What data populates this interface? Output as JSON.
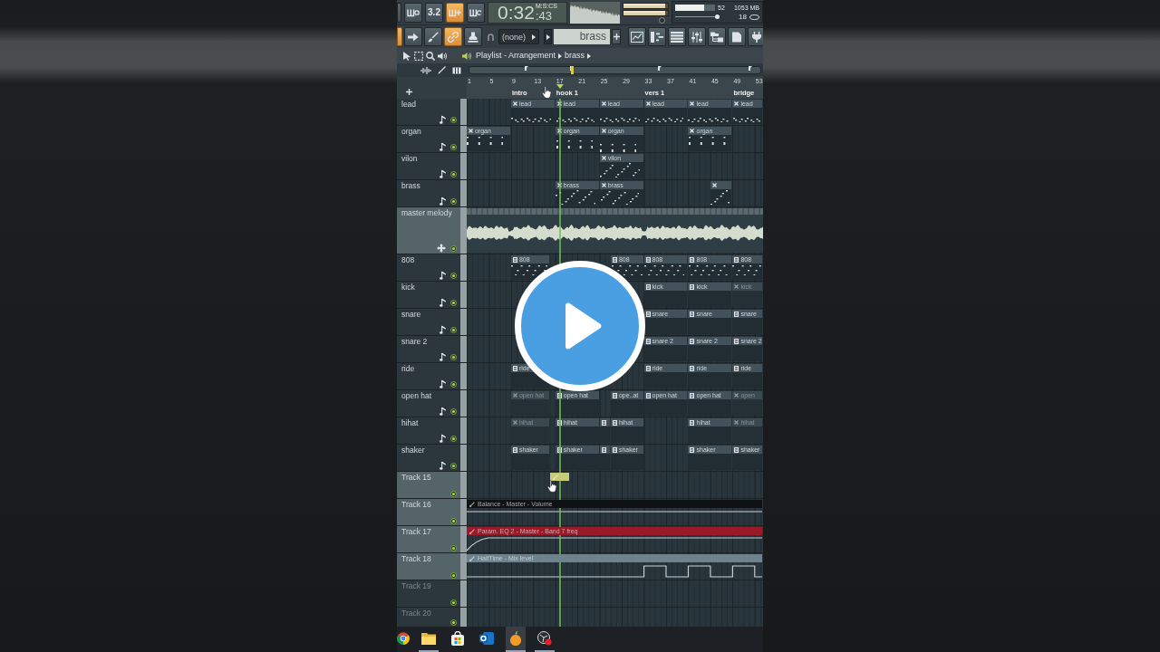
{
  "toolbar": {
    "top_buttons": [
      {
        "kind": "sliver",
        "on": false
      },
      {
        "kind": "typing",
        "on": false
      },
      {
        "kind": "countdown",
        "label": "3.2",
        "on": false
      },
      {
        "kind": "overdub",
        "on": true
      },
      {
        "kind": "loop",
        "on": false
      }
    ],
    "time": {
      "main": "0:32",
      "fraction": ":43",
      "units": "M:S:CS"
    },
    "meters": [
      {
        "level": 0.93
      },
      {
        "level": 0.93
      }
    ],
    "usage": {
      "meter": {
        "level": 0.72
      },
      "reading": "52",
      "memory": "1053 MB",
      "slider": {
        "level": 0.97
      },
      "voices": "18"
    },
    "bottom_buttons": [
      {
        "kind": "sliver",
        "on": true
      },
      {
        "kind": "arrow",
        "on": false
      },
      {
        "kind": "brush",
        "on": false
      },
      {
        "kind": "link",
        "on": true
      },
      {
        "kind": "stamp",
        "on": false
      }
    ],
    "snap": "(none)",
    "pattern": "brass"
  },
  "playlist": {
    "path": [
      "Playlist - Arrangement",
      "brass"
    ]
  },
  "ruler": {
    "bars": [
      "1",
      "5",
      "9",
      "13",
      "17",
      "21",
      "25",
      "29",
      "33",
      "37",
      "41",
      "45",
      "49",
      "53"
    ],
    "markers": [
      "intro",
      "hook 1",
      "vers 1",
      "bridge"
    ]
  },
  "tracks": [
    {
      "name": "lead",
      "kind": "instrument",
      "selected": false,
      "enabled": true,
      "clips": [
        {
          "kind": "cross",
          "dimmed": false,
          "label": "lead"
        },
        {
          "kind": "cross",
          "dimmed": false,
          "label": "lead"
        },
        {
          "kind": "cross",
          "dimmed": false,
          "label": "lead"
        },
        {
          "kind": "cross",
          "dimmed": false,
          "label": "lead"
        },
        {
          "kind": "cross",
          "dimmed": false,
          "label": "lead"
        },
        {
          "kind": "cross",
          "dimmed": false,
          "label": "lead"
        }
      ]
    },
    {
      "name": "organ",
      "kind": "instrument",
      "selected": false,
      "enabled": true,
      "clips": [
        {
          "kind": "cross",
          "dimmed": false,
          "label": "organ"
        },
        {
          "kind": "cross",
          "dimmed": false,
          "label": "organ"
        },
        {
          "kind": "cross",
          "dimmed": false,
          "label": "organ"
        },
        {
          "kind": "cross",
          "dimmed": false,
          "label": "organ"
        }
      ]
    },
    {
      "name": "vilon",
      "kind": "instrument",
      "selected": false,
      "enabled": true,
      "clips": [
        {
          "kind": "cross",
          "dimmed": false,
          "label": "vilon"
        }
      ]
    },
    {
      "name": "brass",
      "kind": "instrument",
      "selected": false,
      "enabled": true,
      "clips": [
        {
          "kind": "cross",
          "dimmed": false,
          "label": "brass"
        },
        {
          "kind": "cross",
          "dimmed": false,
          "label": "brass"
        },
        {
          "kind": "cross",
          "dimmed": false
        }
      ]
    },
    {
      "name": "master melody",
      "kind": "audio",
      "selected": true,
      "enabled": true
    },
    {
      "name": "808",
      "kind": "instrument",
      "selected": false,
      "enabled": true,
      "clips": [
        {
          "kind": "list",
          "dimmed": false,
          "label": "808"
        },
        {
          "kind": "list",
          "dimmed": false,
          "label": "808"
        },
        {
          "kind": "list",
          "dimmed": false,
          "label": "808"
        },
        {
          "kind": "list",
          "dimmed": false,
          "label": "808"
        },
        {
          "kind": "list",
          "dimmed": false,
          "label": "808"
        }
      ]
    },
    {
      "name": "kick",
      "kind": "instrument",
      "selected": false,
      "enabled": true,
      "clips": [
        {
          "kind": "list",
          "dimmed": false,
          "label": "kick"
        },
        {
          "kind": "list",
          "dimmed": false,
          "label": "kick"
        },
        {
          "kind": "cross",
          "dimmed": true,
          "label": "kick"
        }
      ]
    },
    {
      "name": "snare",
      "kind": "instrument",
      "selected": false,
      "enabled": true,
      "clips": [
        {
          "kind": "list",
          "dimmed": false,
          "label": "snare"
        },
        {
          "kind": "list",
          "dimmed": false,
          "label": "snare"
        },
        {
          "kind": "list",
          "dimmed": false,
          "label": "snare"
        }
      ]
    },
    {
      "name": "snare 2",
      "kind": "instrument",
      "selected": false,
      "enabled": true,
      "clips": [
        {
          "kind": "list",
          "dimmed": false,
          "label": "snare 2"
        },
        {
          "kind": "list",
          "dimmed": false,
          "label": "snare 2"
        },
        {
          "kind": "list",
          "dimmed": false,
          "label": "snare 2"
        }
      ]
    },
    {
      "name": "ride",
      "kind": "instrument",
      "selected": false,
      "enabled": true,
      "clips": [
        {
          "kind": "list",
          "dimmed": false,
          "label": "ride"
        },
        {
          "kind": "list",
          "dimmed": false,
          "label": "ride"
        },
        {
          "kind": "list",
          "dimmed": false,
          "label": "ride"
        },
        {
          "kind": "list",
          "dimmed": false,
          "label": "ride"
        }
      ]
    },
    {
      "name": "open hat",
      "kind": "instrument",
      "selected": false,
      "enabled": true,
      "clips": [
        {
          "kind": "cross",
          "dimmed": true,
          "label": "open hat"
        },
        {
          "kind": "list",
          "dimmed": false,
          "label": "open hat"
        },
        {
          "kind": "list",
          "dimmed": false,
          "label": "ope..at"
        },
        {
          "kind": "list",
          "dimmed": false,
          "label": "open hat"
        },
        {
          "kind": "list",
          "dimmed": false,
          "label": "open hat"
        },
        {
          "kind": "cross",
          "dimmed": true,
          "label": "open"
        }
      ]
    },
    {
      "name": "hihat",
      "kind": "instrument",
      "selected": false,
      "enabled": true,
      "clips": [
        {
          "kind": "cross",
          "dimmed": true,
          "label": "hihat"
        },
        {
          "kind": "list",
          "dimmed": false,
          "label": "hihat"
        },
        {
          "kind": "list",
          "dimmed": false
        },
        {
          "kind": "list",
          "dimmed": false,
          "label": "hihat"
        },
        {
          "kind": "list",
          "dimmed": false,
          "label": "hihat"
        },
        {
          "kind": "cross",
          "dimmed": true,
          "label": "hihat"
        }
      ]
    },
    {
      "name": "shaker",
      "kind": "instrument",
      "selected": false,
      "enabled": true,
      "clips": [
        {
          "kind": "list",
          "dimmed": false,
          "label": "shaker"
        },
        {
          "kind": "list",
          "dimmed": false,
          "label": "shaker"
        },
        {
          "kind": "list",
          "dimmed": false
        },
        {
          "kind": "list",
          "dimmed": false,
          "label": "shaker"
        },
        {
          "kind": "list",
          "dimmed": false,
          "label": "shaker"
        },
        {
          "kind": "list",
          "dimmed": false,
          "label": "shaker"
        }
      ]
    },
    {
      "name": "Track 15",
      "kind": "automation",
      "selected": true,
      "enabled": true,
      "clips": [
        {
          "kind": "automation",
          "color": "#c5cb78"
        }
      ]
    },
    {
      "name": "Track 16",
      "kind": "automation",
      "selected": true,
      "enabled": true,
      "clips": [
        {
          "kind": "automation",
          "color": "#0e1215",
          "label": "Balance - Master - Volume"
        }
      ]
    },
    {
      "name": "Track 17",
      "kind": "automation",
      "selected": true,
      "enabled": true,
      "clips": [
        {
          "kind": "automation",
          "color": "#9a1a2a",
          "label": "Param. EQ 2 - Master - Band 7 freq"
        }
      ]
    },
    {
      "name": "Track 18",
      "kind": "automation",
      "selected": true,
      "enabled": true,
      "clips": [
        {
          "kind": "automation",
          "color": "#6e828b",
          "label": "HalfTime - Mix level"
        }
      ]
    },
    {
      "name": "Track 19",
      "kind": "empty",
      "selected": false,
      "enabled": true
    },
    {
      "name": "Track 20",
      "kind": "empty",
      "selected": false,
      "enabled": true
    }
  ],
  "taskbar": [
    {
      "kind": "globe",
      "selected": false,
      "running": false
    },
    {
      "kind": "folder",
      "selected": false,
      "running": true
    },
    {
      "kind": "bag",
      "selected": false,
      "running": false
    },
    {
      "kind": "mail",
      "selected": false,
      "running": false
    },
    {
      "kind": "fruit",
      "selected": true,
      "running": true
    },
    {
      "kind": "record",
      "selected": false,
      "running": true
    }
  ]
}
